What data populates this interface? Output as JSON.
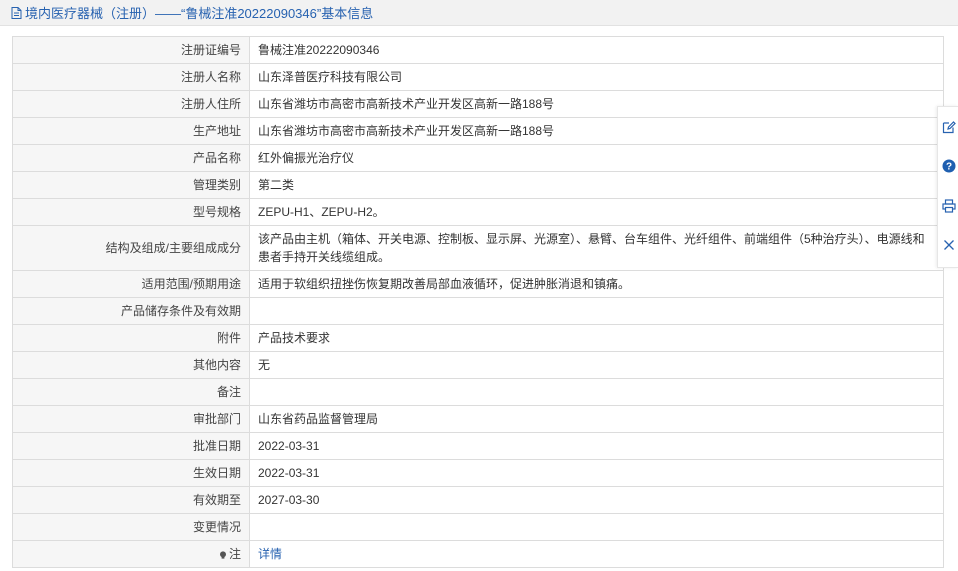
{
  "header": {
    "title": "境内医疗器械（注册）——“鲁械注准20222090346”基本信息",
    "icon": "document-icon"
  },
  "rows": [
    {
      "label": "注册证编号",
      "value": "鲁械注准20222090346"
    },
    {
      "label": "注册人名称",
      "value": "山东泽普医疗科技有限公司"
    },
    {
      "label": "注册人住所",
      "value": "山东省潍坊市高密市高新技术产业开发区高新一路188号"
    },
    {
      "label": "生产地址",
      "value": "山东省潍坊市高密市高新技术产业开发区高新一路188号"
    },
    {
      "label": "产品名称",
      "value": "红外偏振光治疗仪"
    },
    {
      "label": "管理类别",
      "value": "第二类"
    },
    {
      "label": "型号规格",
      "value": "ZEPU-H1、ZEPU-H2。"
    },
    {
      "label": "结构及组成/主要组成成分",
      "value": "该产品由主机（箱体、开关电源、控制板、显示屏、光源室）、悬臂、台车组件、光纤组件、前端组件（5种治疗头）、电源线和患者手持开关线缆组成。"
    },
    {
      "label": "适用范围/预期用途",
      "value": "适用于软组织扭挫伤恢复期改善局部血液循环，促进肿胀消退和镇痛。"
    },
    {
      "label": "产品储存条件及有效期",
      "value": ""
    },
    {
      "label": "附件",
      "value": "产品技术要求"
    },
    {
      "label": "其他内容",
      "value": "无"
    },
    {
      "label": "备注",
      "value": ""
    },
    {
      "label": "审批部门",
      "value": "山东省药品监督管理局"
    },
    {
      "label": "批准日期",
      "value": "2022-03-31"
    },
    {
      "label": "生效日期",
      "value": "2022-03-31"
    },
    {
      "label": "有效期至",
      "value": "2027-03-30"
    },
    {
      "label": "变更情况",
      "value": ""
    },
    {
      "label": "注",
      "value": "详情"
    }
  ],
  "float_bar": [
    "edit-icon",
    "help-icon",
    "print-icon",
    "close-icon"
  ],
  "colors": {
    "link": "#2762b0",
    "help_badge": "#1f5fb0"
  }
}
